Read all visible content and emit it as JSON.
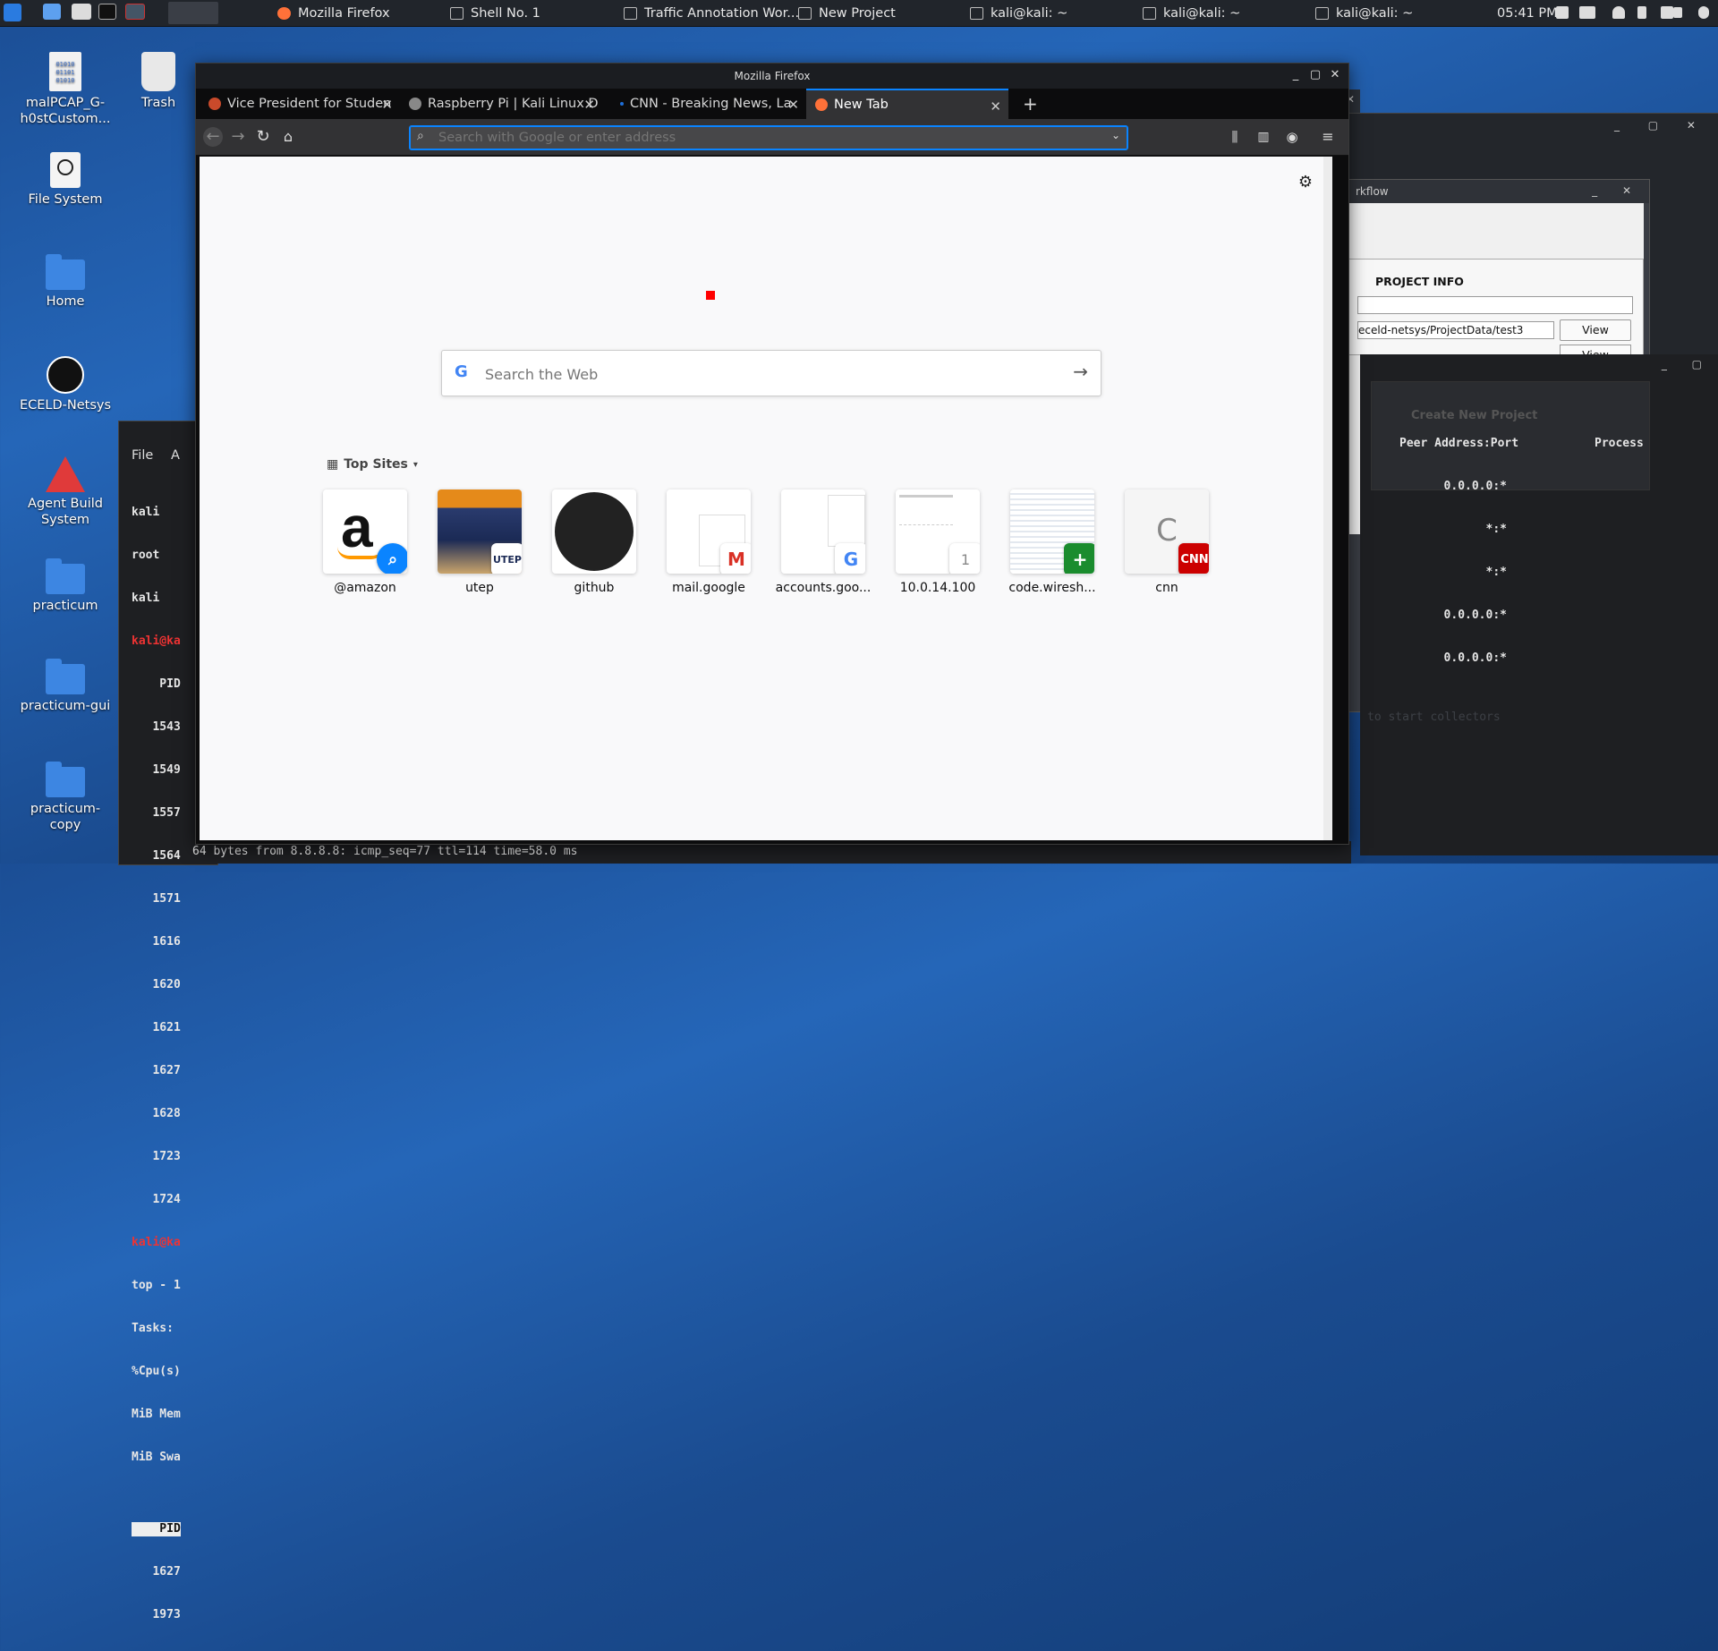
{
  "taskbar": {
    "tasks": [
      "Mozilla Firefox",
      "Shell No. 1",
      "Traffic Annotation Wor...",
      "New Project",
      "kali@kali: ~",
      "kali@kali: ~",
      "kali@kali: ~"
    ],
    "clock": "05:41 PM"
  },
  "desktop": {
    "icons": [
      "malPCAP_G-h0stCustom...",
      "Trash",
      "File System",
      "Home",
      "ECELD-Netsys",
      "Agent Build System",
      "practicum",
      "practicum-gui",
      "practicum-copy"
    ]
  },
  "terminal": {
    "menu_file": "File",
    "menu_a": "A",
    "lines": [
      "kali",
      "root",
      "kali",
      "kali@ka",
      "    PID",
      "   1543",
      "   1549",
      "   1557",
      "   1564",
      "   1571",
      "   1616",
      "   1620",
      "   1621",
      "   1627",
      "   1628",
      "   1723",
      "   1724",
      "kali@ka",
      "top - 1",
      "Tasks:",
      "%Cpu(s)",
      "MiB Mem",
      "MiB Swa",
      "",
      "    PID",
      "   1627",
      "   1973"
    ],
    "bottom_lines": [
      "64 bytes from 8.8.8.8: icmp_seq=77 ttl=114 time=58.0 ms"
    ]
  },
  "bgwindow": {
    "title_fragment": "rkflow",
    "section": "PROJECT INFO",
    "path_value": "eceld-netsys/ProjectData/test3",
    "view_label": "View",
    "view2_label": "View",
    "header_peer": "Peer Address:Port",
    "header_process": "Process",
    "rows": [
      "0.0.0.0:*",
      "*:*",
      "*:*",
      "0.0.0.0:*",
      "0.0.0.0:*"
    ],
    "ghost1": "Create New Project",
    "ghost2": "to start collectors"
  },
  "firefox": {
    "title": "Mozilla Firefox",
    "tabs": [
      {
        "label": "Vice President for Studen",
        "color": "#c94a2b"
      },
      {
        "label": "Raspberry Pi | Kali Linux D",
        "color": "#888888"
      },
      {
        "label": "CNN - Breaking News, La",
        "color": "#1e6fd9"
      },
      {
        "label": "New Tab",
        "color": "#ff7139"
      }
    ],
    "urlbar_placeholder": "Search with Google or enter address",
    "websearch_placeholder": "Search the Web",
    "top_sites_label": "Top Sites",
    "sites": [
      {
        "label": "@amazon",
        "badge": "search"
      },
      {
        "label": "utep",
        "badge": "UTEP"
      },
      {
        "label": "github",
        "badge": ""
      },
      {
        "label": "mail.google",
        "badge": "M"
      },
      {
        "label": "accounts.goo...",
        "badge": "G"
      },
      {
        "label": "10.0.14.100",
        "badge": "1"
      },
      {
        "label": "code.wiresh...",
        "badge": "+"
      },
      {
        "label": "cnn",
        "badge": "CNN",
        "tile_letter": "C"
      }
    ]
  }
}
